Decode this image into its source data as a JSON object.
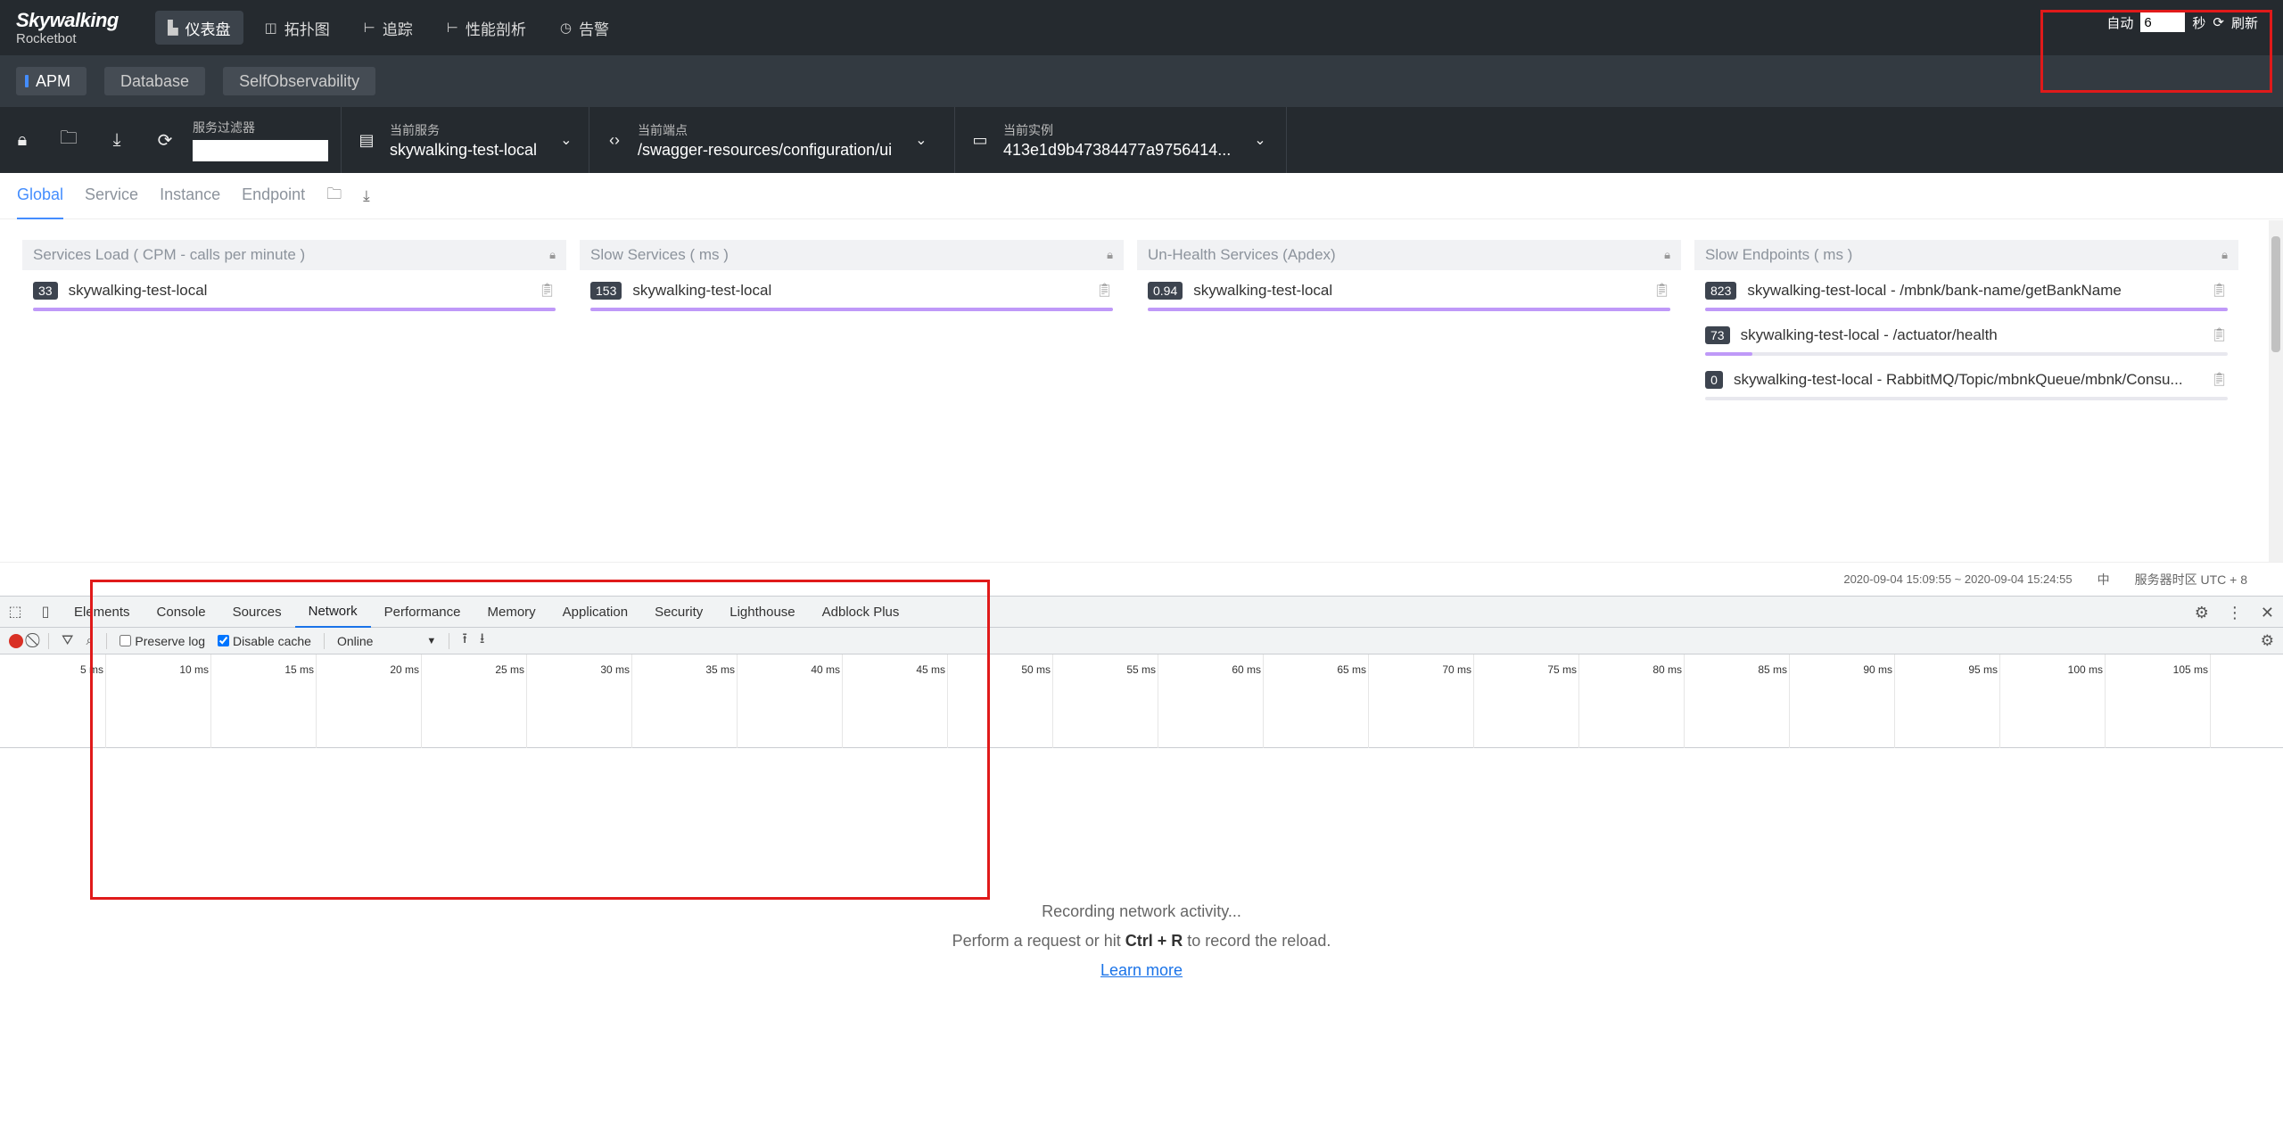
{
  "brand": {
    "name": "Skywalking",
    "sub": "Rocketbot"
  },
  "nav": [
    {
      "label": "仪表盘",
      "icon": "dashboard-icon",
      "glyph": "▙",
      "active": true
    },
    {
      "label": "拓扑图",
      "icon": "topology-icon",
      "glyph": "◫",
      "active": false
    },
    {
      "label": "追踪",
      "icon": "trace-icon",
      "glyph": "⊢",
      "active": false
    },
    {
      "label": "性能剖析",
      "icon": "profile-icon",
      "glyph": "⊢",
      "active": false
    },
    {
      "label": "告警",
      "icon": "alarm-icon",
      "glyph": "◷",
      "active": false
    }
  ],
  "auto_refresh": {
    "label": "自动",
    "value": "6",
    "unit": "秒",
    "refresh_label": "刷新"
  },
  "subnav": [
    "APM",
    "Database",
    "SelfObservability"
  ],
  "toolbar": {
    "filter_label": "服务过滤器",
    "filter_value": "",
    "service": {
      "label": "当前服务",
      "value": "skywalking-test-local"
    },
    "endpoint": {
      "label": "当前端点",
      "value": "/swagger-resources/configuration/ui"
    },
    "instance": {
      "label": "当前实例",
      "value": "413e1d9b47384477a9756414..."
    }
  },
  "dashboard_tabs": [
    "Global",
    "Service",
    "Instance",
    "Endpoint"
  ],
  "cards": [
    {
      "title": "Services Load ( CPM - calls per minute )",
      "rows": [
        {
          "value": "33",
          "name": "skywalking-test-local",
          "fill": 1.0
        }
      ]
    },
    {
      "title": "Slow Services ( ms )",
      "rows": [
        {
          "value": "153",
          "name": "skywalking-test-local",
          "fill": 1.0
        }
      ]
    },
    {
      "title": "Un-Health Services (Apdex)",
      "rows": [
        {
          "value": "0.94",
          "name": "skywalking-test-local",
          "fill": 1.0
        }
      ]
    },
    {
      "title": "Slow Endpoints ( ms )",
      "rows": [
        {
          "value": "823",
          "name": "skywalking-test-local - /mbnk/bank-name/getBankName",
          "fill": 1.0
        },
        {
          "value": "73",
          "name": "skywalking-test-local - /actuator/health",
          "fill": 0.09
        },
        {
          "value": "0",
          "name": "skywalking-test-local - RabbitMQ/Topic/mbnkQueue/mbnk/Consu...",
          "fill": 0.0
        }
      ]
    }
  ],
  "status": {
    "range": "2020-09-04 15:09:55 ~ 2020-09-04 15:24:55",
    "lang": "中",
    "timezone": "服务器时区 UTC + 8"
  },
  "devtools": {
    "tabs": [
      "Elements",
      "Console",
      "Sources",
      "Network",
      "Performance",
      "Memory",
      "Application",
      "Security",
      "Lighthouse",
      "Adblock Plus"
    ],
    "active_tab": "Network",
    "preserve_log": "Preserve log",
    "disable_cache": "Disable cache",
    "throttle": "Online",
    "ticks": [
      "5 ms",
      "10 ms",
      "15 ms",
      "20 ms",
      "25 ms",
      "30 ms",
      "35 ms",
      "40 ms",
      "45 ms",
      "50 ms",
      "55 ms",
      "60 ms",
      "65 ms",
      "70 ms",
      "75 ms",
      "80 ms",
      "85 ms",
      "90 ms",
      "95 ms",
      "100 ms",
      "105 ms"
    ],
    "empty_line1": "Recording network activity...",
    "empty_line2_pre": "Perform a request or hit ",
    "empty_line2_key": "Ctrl + R",
    "empty_line2_post": " to record the reload.",
    "learn_more": "Learn more"
  }
}
